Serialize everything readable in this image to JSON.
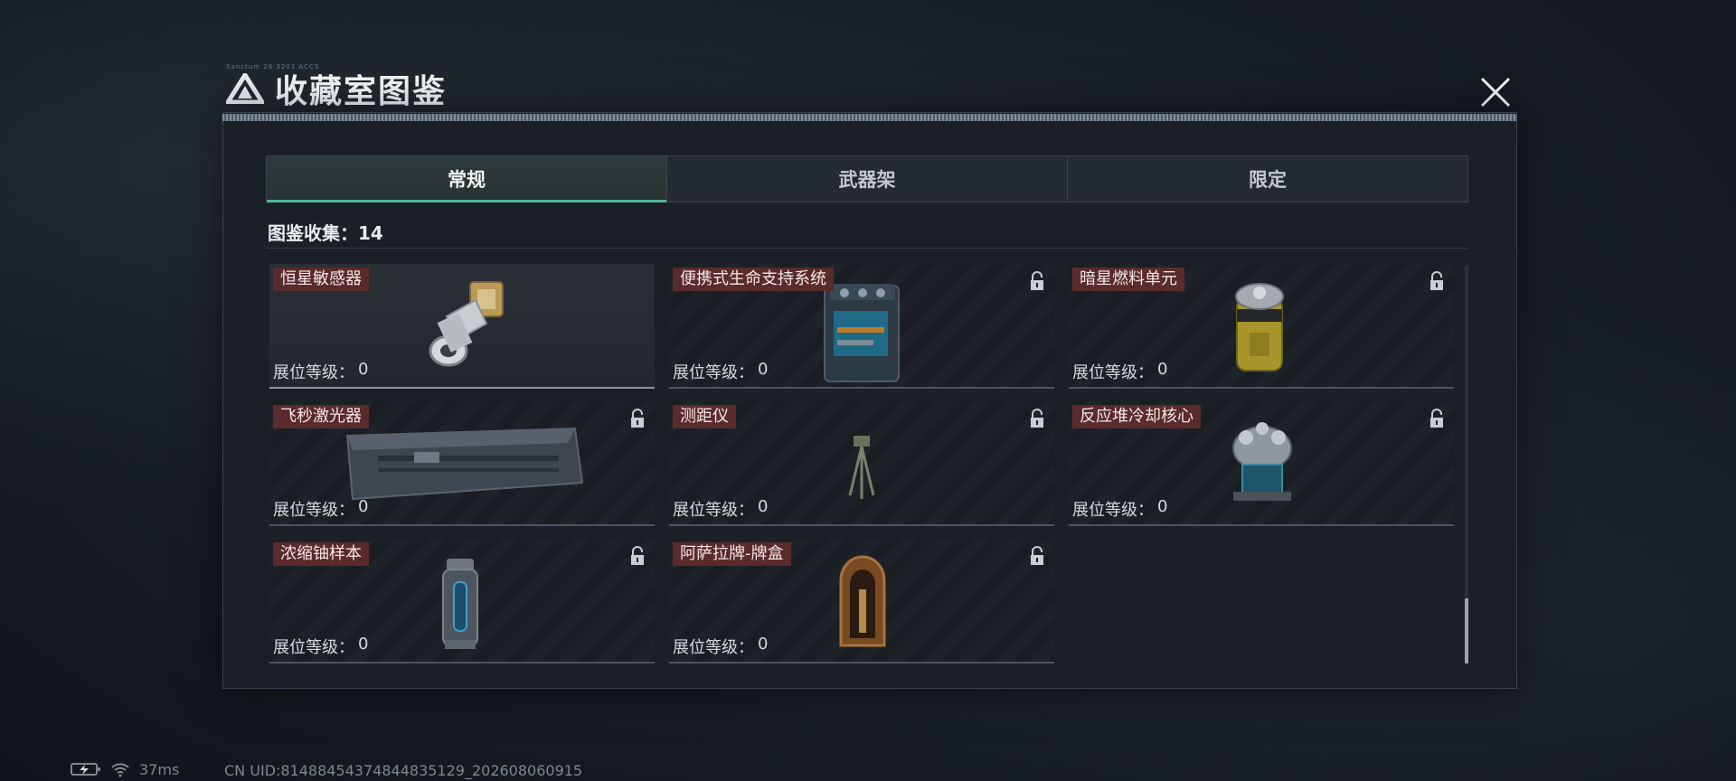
{
  "header": {
    "title": "收藏室图鉴",
    "tiny_caption": "Sanctum 28 3201 ACCS"
  },
  "tabs": [
    {
      "label": "常规",
      "active": true
    },
    {
      "label": "武器架",
      "active": false
    },
    {
      "label": "限定",
      "active": false
    }
  ],
  "collection": {
    "label": "图鉴收集：",
    "count": "14"
  },
  "items": [
    {
      "name": "恒星敏感器",
      "level_label": "展位等级：",
      "level": "0",
      "locked": false,
      "icon": "star-sensor-icon"
    },
    {
      "name": "便携式生命支持系统",
      "level_label": "展位等级：",
      "level": "0",
      "locked": true,
      "icon": "life-support-icon"
    },
    {
      "name": "暗星燃料单元",
      "level_label": "展位等级：",
      "level": "0",
      "locked": true,
      "icon": "fuel-cell-icon"
    },
    {
      "name": "飞秒激光器",
      "level_label": "展位等级：",
      "level": "0",
      "locked": true,
      "icon": "laser-case-icon"
    },
    {
      "name": "测距仪",
      "level_label": "展位等级：",
      "level": "0",
      "locked": true,
      "icon": "rangefinder-icon"
    },
    {
      "name": "反应堆冷却核心",
      "level_label": "展位等级：",
      "level": "0",
      "locked": true,
      "icon": "reactor-core-icon"
    },
    {
      "name": "浓缩铀样本",
      "level_label": "展位等级：",
      "level": "0",
      "locked": true,
      "icon": "uranium-sample-icon"
    },
    {
      "name": "阿萨拉牌-牌盒",
      "level_label": "展位等级：",
      "level": "0",
      "locked": true,
      "icon": "card-box-icon"
    }
  ],
  "status": {
    "ping": "37ms",
    "uid": "CN UID:814884543748448351​29_202608060915"
  },
  "colors": {
    "accent": "#4fb79a",
    "name_bg": "#5a2b2b",
    "panel": "#1b2027"
  }
}
